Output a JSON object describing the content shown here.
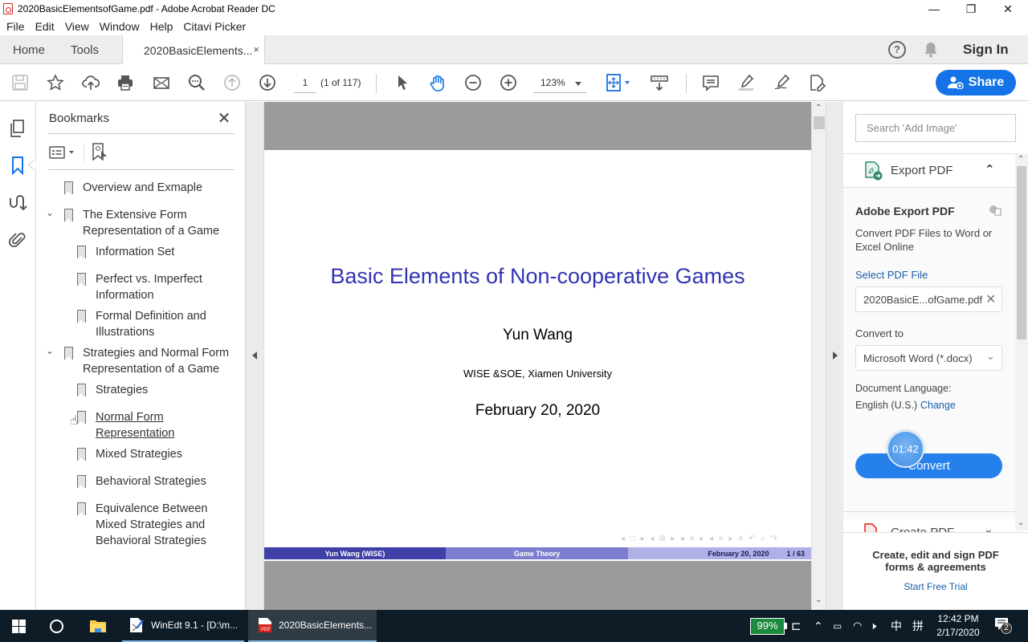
{
  "window": {
    "title": "2020BasicElementsofGame.pdf - Adobe Acrobat Reader DC",
    "controls": {
      "minimize": "—",
      "maximize": "❐",
      "close": "✕"
    }
  },
  "menu": [
    "File",
    "Edit",
    "View",
    "Window",
    "Help",
    "Citavi Picker"
  ],
  "tabs": {
    "home": "Home",
    "tools": "Tools",
    "document": "2020BasicElements...",
    "close_glyph": "×",
    "sign_in": "Sign In"
  },
  "toolbar": {
    "page_current": "1",
    "page_count": "(1 of 117)",
    "zoom": "123%",
    "share_label": "Share",
    "icons": [
      "save-icon",
      "bookmark-star-icon",
      "upload-cloud-icon",
      "print-icon",
      "email-icon",
      "search-icon",
      "page-up-icon",
      "page-down-icon",
      "select-cursor-icon",
      "hand-tool-icon",
      "zoom-out-icon",
      "zoom-in-icon",
      "fit-page-icon",
      "scroll-mode-icon",
      "comment-icon",
      "highlight-icon",
      "sign-icon",
      "fill-sign-icon"
    ]
  },
  "bookmarks": {
    "title": "Bookmarks",
    "close_glyph": "✕",
    "items": [
      {
        "label": "Overview and Exmaple",
        "level": 0,
        "expanded": null
      },
      {
        "label": "The Extensive Form Representation of a Game",
        "level": 0,
        "expanded": true
      },
      {
        "label": "Information Set",
        "level": 1
      },
      {
        "label": "Perfect vs. Imperfect Information",
        "level": 1
      },
      {
        "label": "Formal Definition and Illustrations",
        "level": 1
      },
      {
        "label": "Strategies and Normal Form Representation of a Game",
        "level": 0,
        "expanded": true
      },
      {
        "label": "Strategies",
        "level": 1
      },
      {
        "label": "Normal Form Representation",
        "level": 1,
        "hovered": true
      },
      {
        "label": "Mixed Strategies",
        "level": 1
      },
      {
        "label": "Behavioral Strategies",
        "level": 1
      },
      {
        "label": "Equivalence Between Mixed Strategies and Behavioral Strategies",
        "level": 1
      }
    ]
  },
  "page": {
    "title": "Basic Elements of Non-cooperative Games",
    "author": "Yun Wang",
    "institute": "WISE &SOE, Xiamen University",
    "date": "February 20, 2020",
    "nav_symbols": "◂ □ ▸ ◂ ⧉ ▸ ◂ ≡ ▸ ◂ ≡ ▸   ≡   ↶ ⌕ ↷",
    "footer": {
      "left": "Yun Wang (WISE)",
      "center": "Game Theory",
      "right_date": "February 20, 2020",
      "right_page": "1 / 63"
    },
    "colors": {
      "title": "#3333b2",
      "footer_left": "#3f3fa8",
      "footer_center": "#7d7dcf",
      "footer_right": "#b0b0e6"
    }
  },
  "right_panel": {
    "search_placeholder": "Search 'Add Image'",
    "export_title": "Export PDF",
    "card_title": "Adobe Export PDF",
    "card_desc": "Convert PDF Files to Word or Excel Online",
    "select_file_link": "Select PDF File",
    "selected_file": "2020BasicE...ofGame.pdf",
    "convert_to_label": "Convert to",
    "convert_to_value": "Microsoft Word (*.docx)",
    "doc_lang_label": "Document Language:",
    "doc_lang_value": "English (U.S.)",
    "change_link": "Change",
    "convert_button": "Convert",
    "timer": "01:42",
    "create_pdf": "Create PDF",
    "promo": "Create, edit and sign PDF forms & agreements",
    "trial_link": "Start Free Trial"
  },
  "taskbar": {
    "apps": [
      {
        "label": "WinEdt 9.1 - [D:\\m...",
        "active": false
      },
      {
        "label": "2020BasicElements...",
        "active": true
      }
    ],
    "battery": "99%",
    "ime1": "中",
    "ime2": "拼",
    "time": "12:42 PM",
    "date": "2/17/2020",
    "notifications": "2"
  }
}
